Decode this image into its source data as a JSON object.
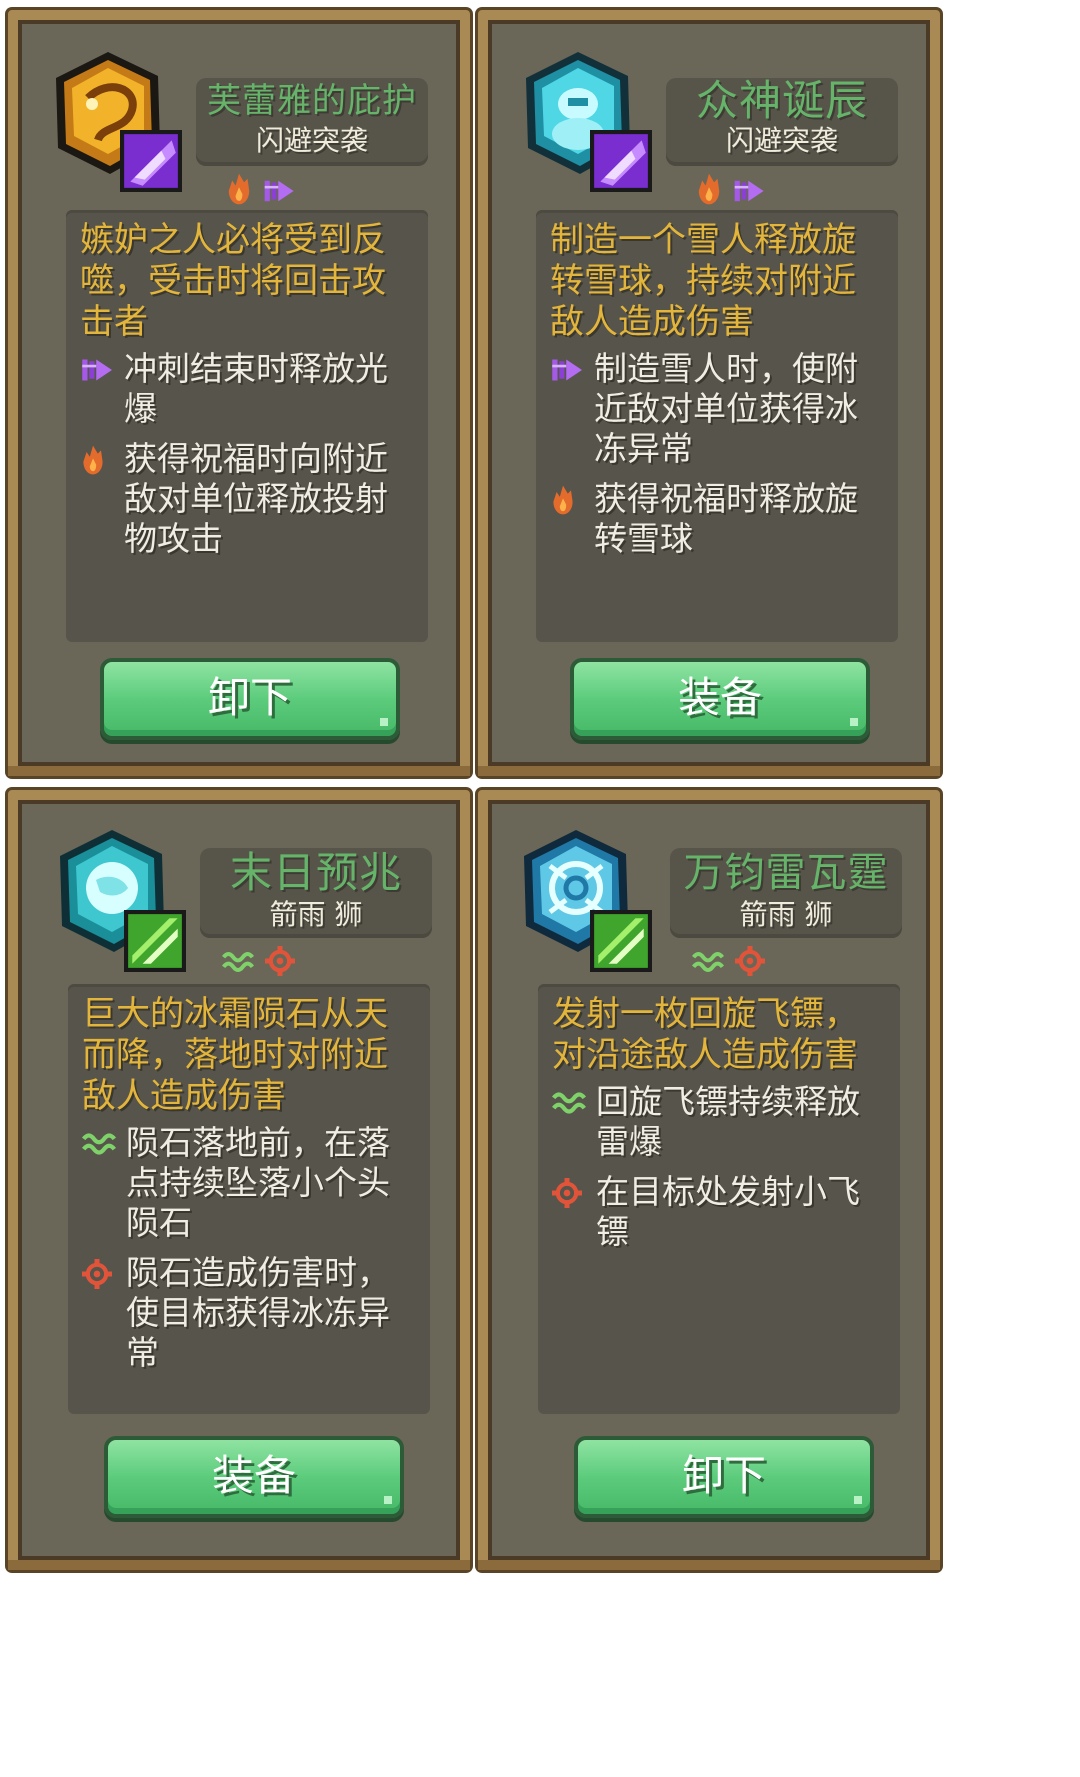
{
  "cards": [
    {
      "name": "芙蕾雅的庇护",
      "category": "闪避突袭",
      "description": "嫉妒之人必将受到反噬，受击时将回击攻击者",
      "effects": [
        {
          "icon": "purple-dash-icon",
          "text": "冲刺结束时释放光爆"
        },
        {
          "icon": "orange-flame-icon",
          "text": "获得祝福时向附近敌对单位释放投射物攻击"
        }
      ],
      "button": "卸下",
      "icon_name": "golden-dragon-icon",
      "badge_name": "purple-dash-badge-icon"
    },
    {
      "name": "众神诞辰",
      "category": "闪避突袭",
      "description": "制造一个雪人释放旋转雪球，持续对附近敌人造成伤害",
      "effects": [
        {
          "icon": "purple-dash-icon",
          "text": "制造雪人时，使附近敌对单位获得冰冻异常"
        },
        {
          "icon": "orange-flame-icon",
          "text": "获得祝福时释放旋转雪球"
        }
      ],
      "button": "装备",
      "icon_name": "cyan-snowman-icon",
      "badge_name": "purple-dash-badge-icon"
    },
    {
      "name": "末日预兆",
      "category": "箭雨 狮",
      "description": "巨大的冰霜陨石从天而降，落地时对附近敌人造成伤害",
      "effects": [
        {
          "icon": "green-wave-icon",
          "text": "陨石落地前，在落点持续坠落小个头陨石"
        },
        {
          "icon": "red-gear-icon",
          "text": "陨石造成伤害时，使目标获得冰冻异常"
        }
      ],
      "button": "装备",
      "icon_name": "ice-meteor-icon",
      "badge_name": "green-arrows-badge-icon"
    },
    {
      "name": "万钧雷瓦霆",
      "category": "箭雨 狮",
      "description": "发射一枚回旋飞镖，对沿途敌人造成伤害",
      "effects": [
        {
          "icon": "green-wave-icon",
          "text": "回旋飞镖持续释放雷爆"
        },
        {
          "icon": "red-gear-icon",
          "text": "在目标处发射小飞镖"
        }
      ],
      "button": "卸下",
      "icon_name": "ice-vortex-icon",
      "badge_name": "green-arrows-badge-icon"
    }
  ],
  "colors": {
    "card_bg": "#6b6758",
    "frame": "#a98a55",
    "title_green": "#66b36a",
    "description_yellow": "#e3b53a",
    "button_green": "#5ccc7c"
  }
}
